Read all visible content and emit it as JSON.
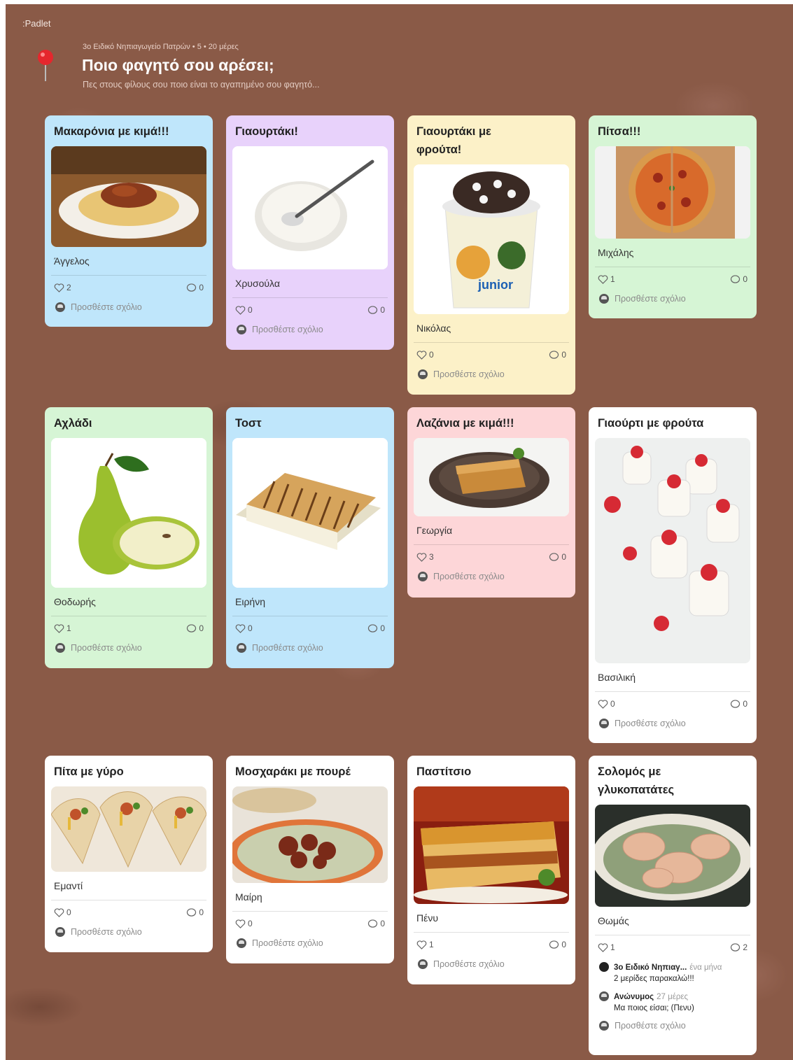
{
  "app": {
    "brand": "Padlet"
  },
  "header": {
    "meta": "3ο Ειδικό Νηπιαγωγείο Πατρών • 5 • 20 μέρες",
    "title": "Ποιο φαγητό σου αρέσει;",
    "subtitle": "Πες στους φίλους σου ποιο είναι το αγαπημένο σου φαγητό..."
  },
  "add_comment_label": "Προσθέστε σχόλιο",
  "posts": [
    {
      "title": "Μακαρόνια με κιμά!!!",
      "author": "Άγγελος",
      "likes": "2",
      "comments": "0",
      "color": "#bfe6fb",
      "image": "spaghetti"
    },
    {
      "title": "Γιαουρτάκι!",
      "author": "Χρυσούλα",
      "likes": "0",
      "comments": "0",
      "color": "#e8d2fb",
      "image": "yogurt-bowl"
    },
    {
      "title": "Γιαουρτάκι με φρούτα!",
      "author": "Νικόλας",
      "likes": "0",
      "comments": "0",
      "color": "#fcf1c8",
      "image": "yogurt-cup"
    },
    {
      "title": "Πίτσα!!!",
      "author": "Μιχάλης",
      "likes": "1",
      "comments": "0",
      "color": "#d6f5d5",
      "image": "pizza"
    },
    {
      "title": "Αχλάδι",
      "author": "Θοδωρής",
      "likes": "1",
      "comments": "0",
      "color": "#d6f5d5",
      "image": "pear"
    },
    {
      "title": "Τοστ",
      "author": "Ειρήνη",
      "likes": "0",
      "comments": "0",
      "color": "#bfe6fb",
      "image": "toast"
    },
    {
      "title": "Λαζάνια με κιμά!!!",
      "author": "Γεωργία",
      "likes": "3",
      "comments": "0",
      "color": "#fdd6d8",
      "image": "lasagna"
    },
    {
      "title": "Γιαούρτι με φρούτα",
      "author": "Βασιλική",
      "likes": "0",
      "comments": "0",
      "color": "#ffffff",
      "image": "yogurt-strawberries"
    },
    {
      "title": "Πίτα με γύρο",
      "author": "Εμαντί",
      "likes": "0",
      "comments": "0",
      "color": "#ffffff",
      "image": "gyros"
    },
    {
      "title": "Μοσχαράκι με πουρέ",
      "author": "Μαίρη",
      "likes": "0",
      "comments": "0",
      "color": "#ffffff",
      "image": "beef-puree"
    },
    {
      "title": "Παστίτσιο",
      "author": "Πένυ",
      "likes": "1",
      "comments": "0",
      "color": "#ffffff",
      "image": "pastitsio"
    },
    {
      "title": "Σολομός με γλυκοπατάτες",
      "author": "Θωμάς",
      "likes": "1",
      "comments": "2",
      "color": "#ffffff",
      "image": "salmon",
      "comment_list": [
        {
          "name": "3ο Ειδικό Νηπιαγ...",
          "time": "ένα μήνα",
          "text": "2 μερίδες παρακαλώ!!!"
        },
        {
          "name": "Ανώνυμος",
          "time": "27 μέρες",
          "text": "Μα ποιος είσαι; (Πενυ)"
        }
      ]
    }
  ]
}
